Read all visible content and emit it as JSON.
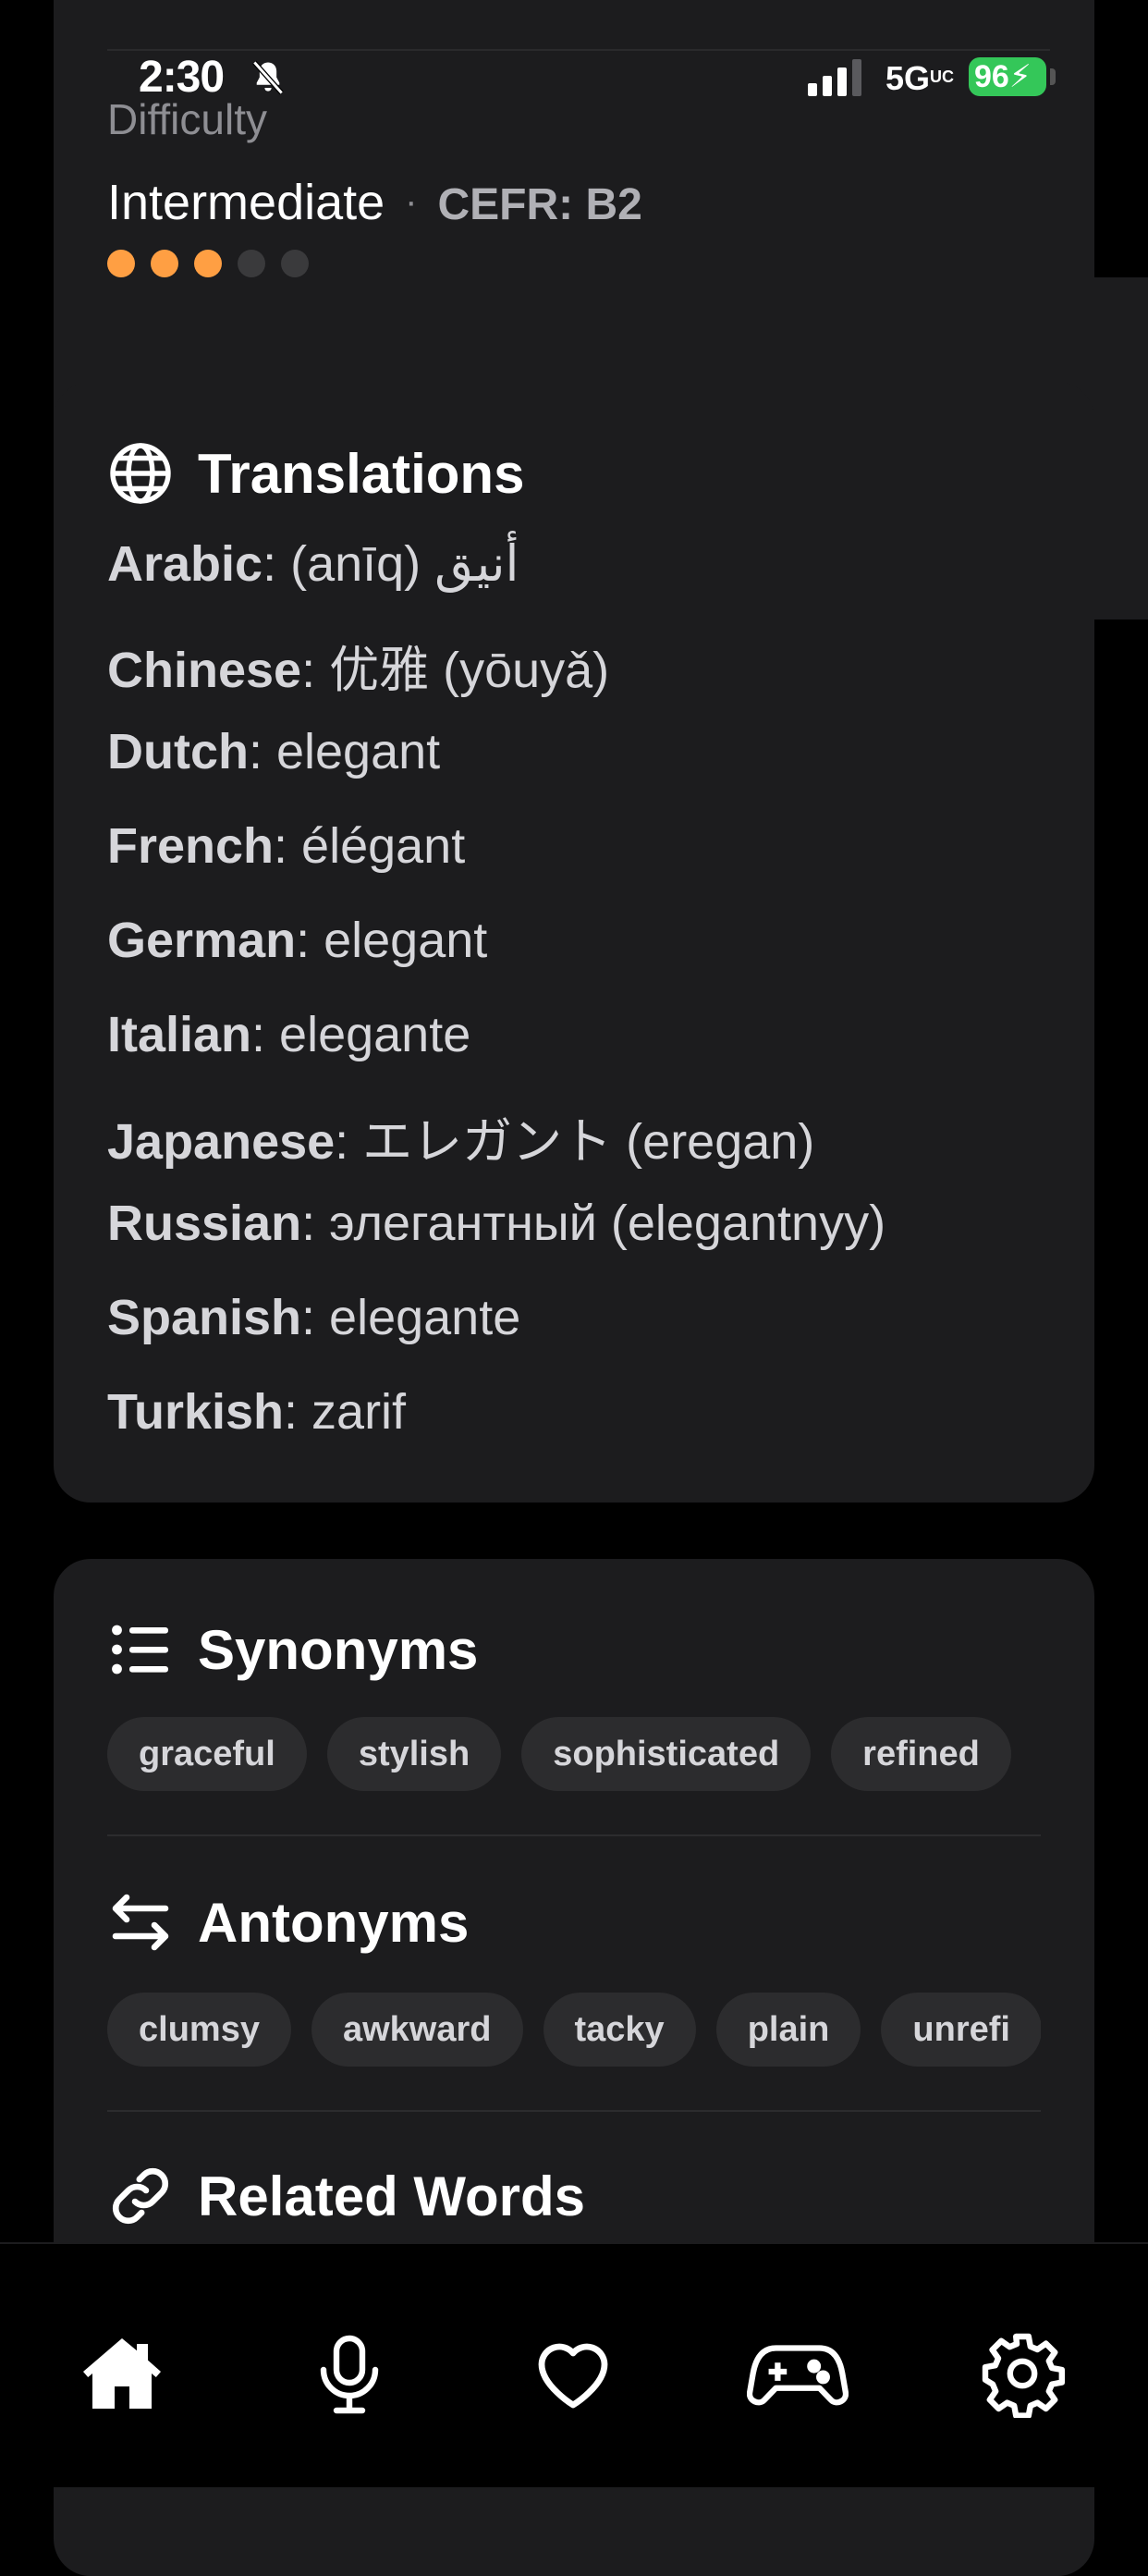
{
  "status_bar": {
    "time": "2:30",
    "network": "5G",
    "network_suffix": "UC",
    "battery": "96"
  },
  "difficulty": {
    "label": "Difficulty",
    "level": "Intermediate",
    "separator": "·",
    "cefr": "CEFR: B2",
    "dots_filled": 3,
    "dots_total": 5,
    "accent_color": "#ff9f43"
  },
  "translations": {
    "title": "Translations",
    "icon": "globe-icon",
    "items": [
      {
        "lang": "Arabic",
        "value": ": (anīq) أنيق"
      },
      {
        "lang": "Chinese",
        "value": ": 优雅 (yōuyǎ)"
      },
      {
        "lang": "Dutch",
        "value": ": elegant"
      },
      {
        "lang": "French",
        "value": ": élégant"
      },
      {
        "lang": "German",
        "value": ": elegant"
      },
      {
        "lang": "Italian",
        "value": ": elegante"
      },
      {
        "lang": "Japanese",
        "value": ": エレガント (eregan)"
      },
      {
        "lang": "Russian",
        "value": ": элегантный (elegantnyy)"
      },
      {
        "lang": "Spanish",
        "value": ": elegante"
      },
      {
        "lang": "Turkish",
        "value": ": zarif"
      }
    ]
  },
  "synonyms": {
    "title": "Synonyms",
    "icon": "list-icon",
    "items": [
      "graceful",
      "stylish",
      "sophisticated",
      "refined"
    ]
  },
  "antonyms": {
    "title": "Antonyms",
    "icon": "swap-arrows-icon",
    "items": [
      "clumsy",
      "awkward",
      "tacky",
      "plain",
      "unrefi"
    ]
  },
  "related": {
    "title": "Related Words",
    "icon": "link-icon"
  },
  "tabs": [
    {
      "name": "home-icon",
      "active": true
    },
    {
      "name": "microphone-icon",
      "active": false
    },
    {
      "name": "heart-icon",
      "active": false
    },
    {
      "name": "gamepad-icon",
      "active": false
    },
    {
      "name": "gear-icon",
      "active": false
    }
  ]
}
